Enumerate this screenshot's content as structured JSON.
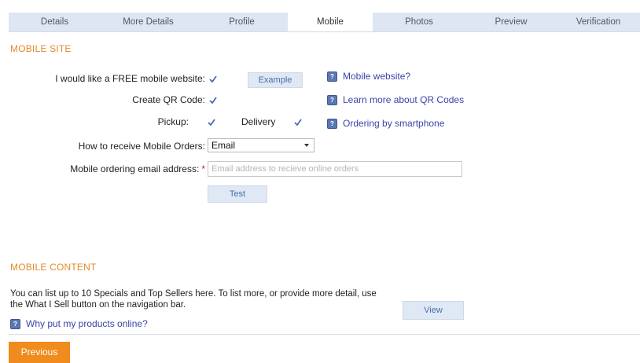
{
  "tabs": [
    "Details",
    "More Details",
    "Profile",
    "Mobile",
    "Photos",
    "Preview",
    "Verification"
  ],
  "active_tab": "Mobile",
  "mobile_site": {
    "title": "MOBILE SITE",
    "free_site_label": "I would like a FREE mobile website:",
    "example_label": "Example",
    "qr_label": "Create QR Code:",
    "pickup_label": "Pickup:",
    "delivery_label": "Delivery",
    "receive_label": "How to receive Mobile Orders:",
    "receive_value": "Email",
    "email_label": "Mobile ordering email address:",
    "required_mark": "*",
    "email_placeholder": "Email address to recieve online orders",
    "test_label": "Test",
    "checkboxes": {
      "free_site": true,
      "qr_code": true,
      "pickup": true,
      "delivery": true
    },
    "help": {
      "mobile_website": "Mobile website?",
      "qr_codes": "Learn more about QR Codes",
      "smartphone": "Ordering by smartphone"
    }
  },
  "mobile_content": {
    "title": "MOBILE CONTENT",
    "description": "You can list up to 10 Specials and Top Sellers here. To list more, or provide more detail, use the What I Sell button on the navigation bar.",
    "view_label": "View",
    "help_products": "Why put my products online?"
  },
  "footer": {
    "previous_label": "Previous"
  },
  "colors": {
    "accent": "#f08c1e",
    "tab_bg": "#dde6f2",
    "link": "#3a44a8",
    "section_title": "#e58a2a"
  }
}
